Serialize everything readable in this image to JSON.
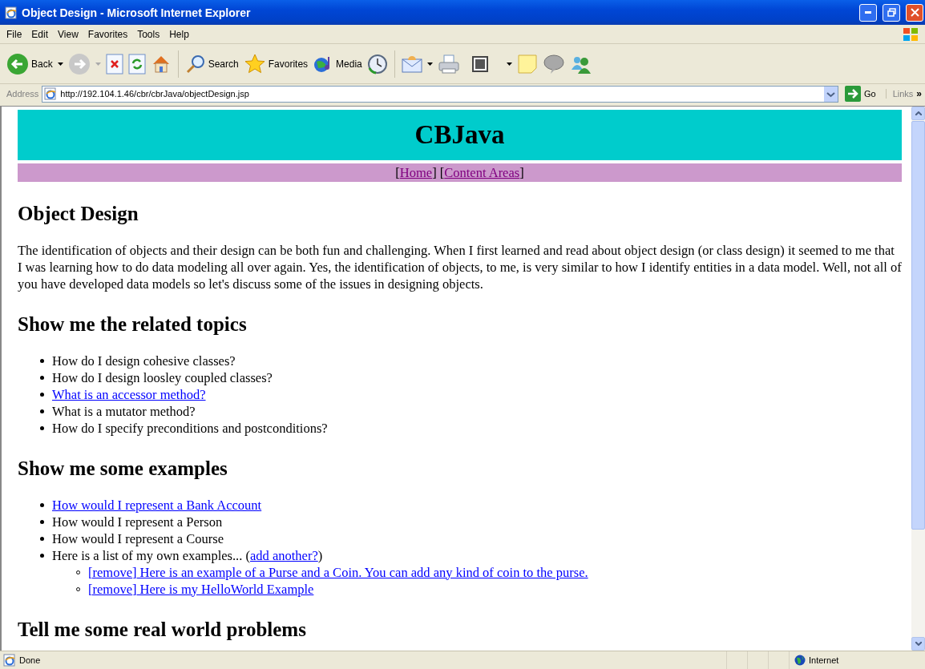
{
  "window": {
    "title": "Object Design - Microsoft Internet Explorer"
  },
  "menu": [
    "File",
    "Edit",
    "View",
    "Favorites",
    "Tools",
    "Help"
  ],
  "toolbar": {
    "back": "Back",
    "search": "Search",
    "favorites": "Favorites",
    "media": "Media"
  },
  "address_bar": {
    "label": "Address",
    "url": "http://192.104.1.46/cbr/cbrJava/objectDesign.jsp",
    "go": "Go",
    "links": "Links",
    "more": "»"
  },
  "page": {
    "banner": "CBJava",
    "nav": [
      {
        "kind": "text",
        "text": "["
      },
      {
        "kind": "link",
        "text": "Home",
        "visited": true
      },
      {
        "kind": "text",
        "text": "] ["
      },
      {
        "kind": "link",
        "text": "Content Areas",
        "visited": true
      },
      {
        "kind": "text",
        "text": "]"
      }
    ],
    "sections": [
      {
        "heading": "Object Design",
        "paragraph": "The identification of objects and their design can be both fun and challenging. When I first learned and read about object design (or class design) it seemed to me that I was learning how to do data modeling all over again. Yes, the identification of objects, to me, is very similar to how I identify entities in a data model. Well, not all of you have developed data models so let's discuss some of the issues in designing objects."
      },
      {
        "heading": "Show me the related topics",
        "items": [
          {
            "segments": [
              {
                "kind": "text",
                "text": "How do I design cohesive classes?"
              }
            ]
          },
          {
            "segments": [
              {
                "kind": "text",
                "text": "How do I design loosley coupled classes?"
              }
            ]
          },
          {
            "segments": [
              {
                "kind": "link",
                "text": "What is an accessor method?",
                "visited": false
              }
            ]
          },
          {
            "segments": [
              {
                "kind": "text",
                "text": "What is a mutator method?"
              }
            ]
          },
          {
            "segments": [
              {
                "kind": "text",
                "text": "How do I specify preconditions and postconditions?"
              }
            ]
          }
        ]
      },
      {
        "heading": "Show me some examples",
        "items": [
          {
            "segments": [
              {
                "kind": "link",
                "text": "How would I represent a Bank Account",
                "visited": false
              }
            ]
          },
          {
            "segments": [
              {
                "kind": "text",
                "text": "How would I represent a Person"
              }
            ]
          },
          {
            "segments": [
              {
                "kind": "text",
                "text": "How would I represent a Course"
              }
            ]
          },
          {
            "segments": [
              {
                "kind": "text",
                "text": "Here is a list of my own examples... ("
              },
              {
                "kind": "link",
                "text": "add another?",
                "visited": false
              },
              {
                "kind": "text",
                "text": ")"
              }
            ],
            "children": [
              {
                "segments": [
                  {
                    "kind": "link",
                    "text": "[remove]",
                    "visited": false
                  },
                  {
                    "kind": "link",
                    "text": " Here is an example of a Purse and a Coin. You can add any kind of coin to the purse.",
                    "visited": false
                  }
                ]
              },
              {
                "segments": [
                  {
                    "kind": "link",
                    "text": "[remove]",
                    "visited": false
                  },
                  {
                    "kind": "link",
                    "text": " Here is my HelloWorld Example",
                    "visited": false
                  }
                ]
              }
            ]
          }
        ]
      },
      {
        "heading": "Tell me some real world problems"
      }
    ]
  },
  "status_bar": {
    "text": "Done",
    "zone": "Internet"
  }
}
